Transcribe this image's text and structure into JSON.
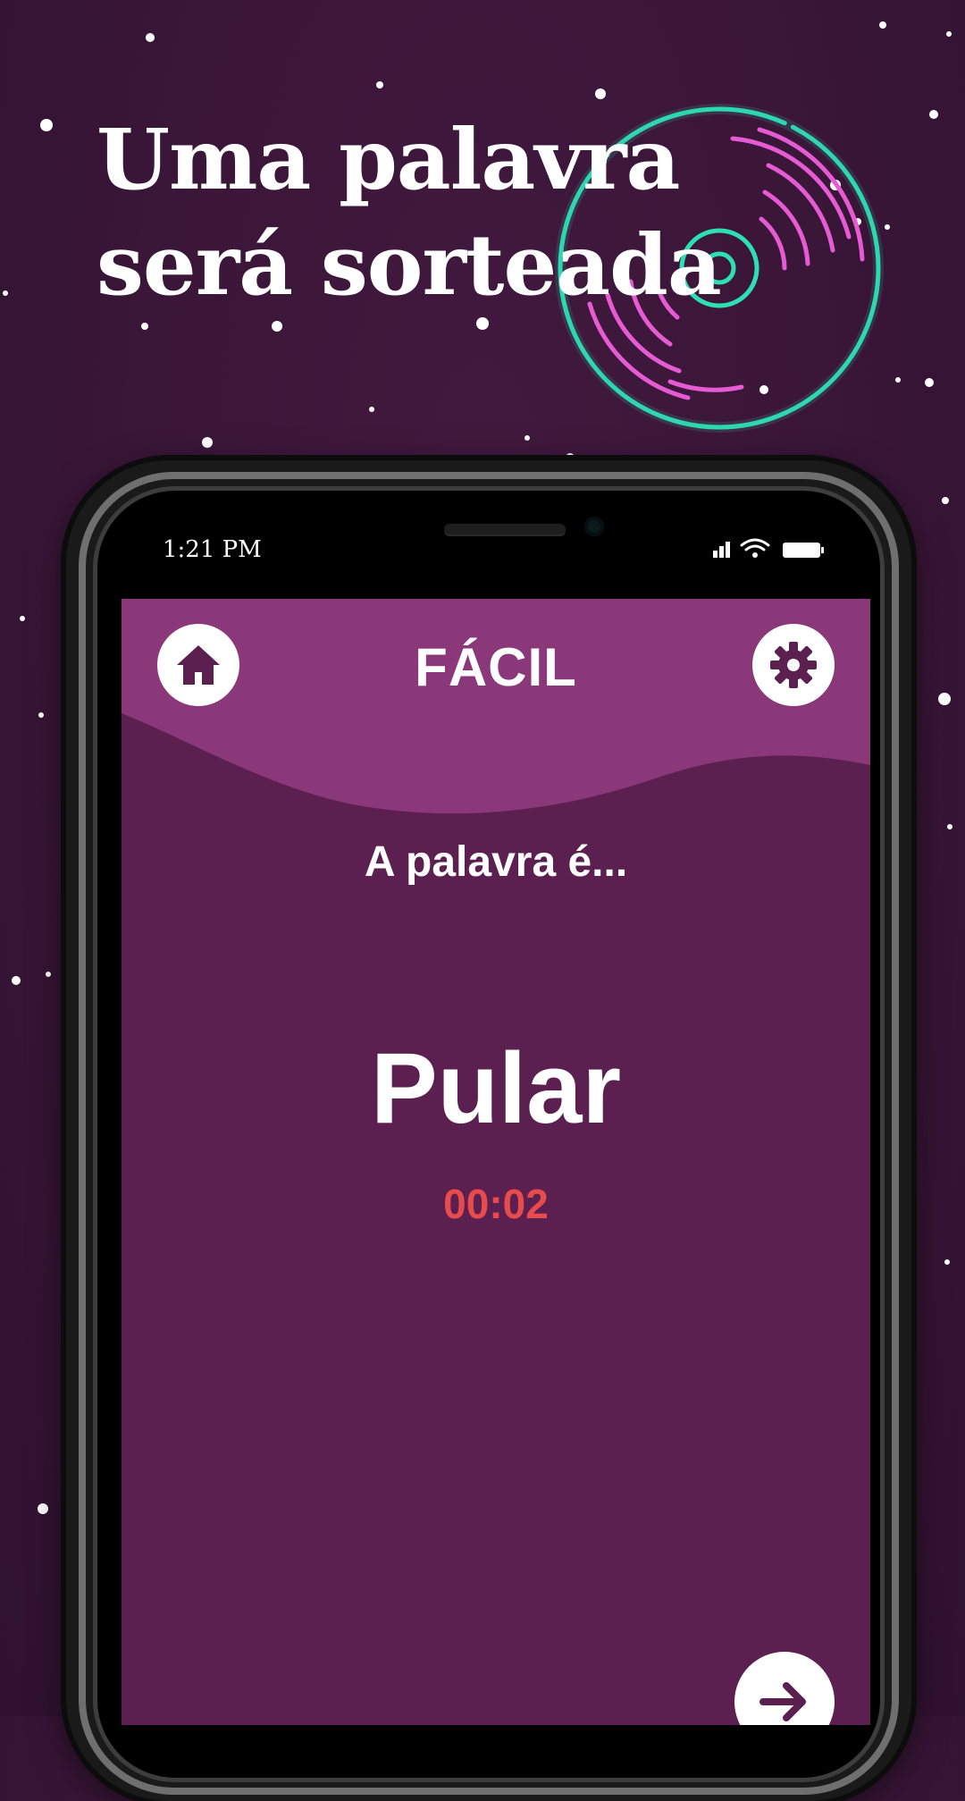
{
  "headline": {
    "line1": "Uma palavra",
    "line2": "será sorteada"
  },
  "status_bar": {
    "time": "1:21 PM"
  },
  "game": {
    "home_icon": "home-icon",
    "settings_icon": "gear-icon",
    "level": "FÁCIL",
    "prompt": "A palavra é...",
    "word": "Pular",
    "timer": "00:02",
    "next_icon": "arrow-right-icon"
  },
  "colors": {
    "background": "#3a1638",
    "header": "#8a3879",
    "screen": "#5b1f50",
    "timer": "#e84b4b",
    "neon_teal": "#2de0b4",
    "neon_pink": "#e65ad3"
  }
}
